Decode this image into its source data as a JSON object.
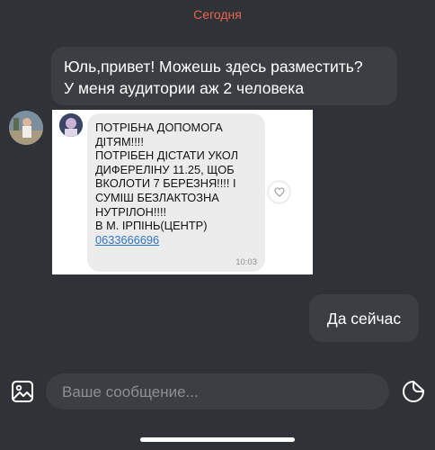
{
  "chat": {
    "date_separator": "Сегодня",
    "messages": [
      {
        "lines": [
          "Юль,привет! Можешь здесь разместить?",
          "У меня аудитории аж 2 человека"
        ]
      },
      {
        "type": "image",
        "image": {
          "text_lines": [
            "ПОТРІБНА ДОПОМОГА",
            "ДІТЯМ!!!!",
            "ПОТРІБЕН ДІСТАТИ УКОЛ",
            "ДИФЕРЕЛІНУ 11.25, ЩОБ",
            "ВКОЛОТИ 7 БЕРЕЗНЯ!!!! І",
            "СУМІШ БЕЗЛАКТОЗНА",
            "НУТРІЛОН!!!!",
            "В М. ІРПІНЬ(ЦЕНТР)"
          ],
          "phone": "0633666696",
          "time": "10:03"
        }
      },
      {
        "text": "Да сейчас"
      }
    ]
  },
  "composer": {
    "placeholder": "Ваше сообщение..."
  },
  "icons": {
    "gallery": "image-gallery-icon",
    "sticker": "sticker-icon",
    "heart": "heart-icon"
  },
  "colors": {
    "background": "#2f3236",
    "bubble": "#3b3f44",
    "date_separator": "#e8664d",
    "link": "#2d74c7"
  }
}
